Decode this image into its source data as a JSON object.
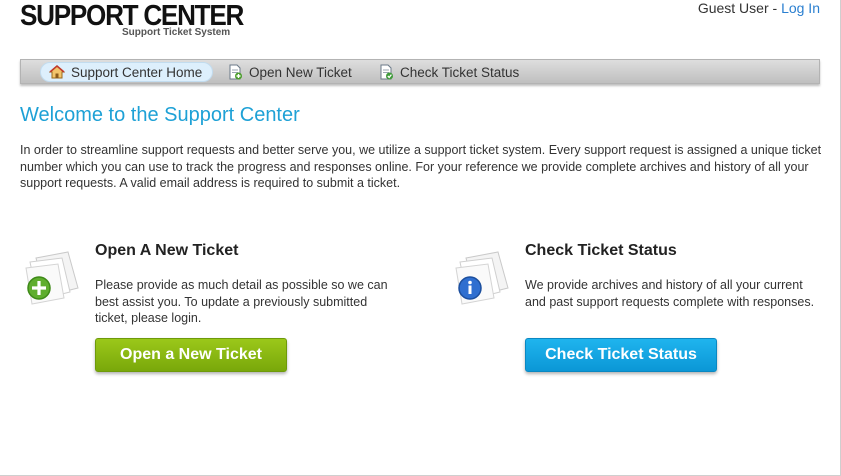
{
  "header": {
    "logo_title": "SUPPORT CENTER",
    "logo_subtitle": "Support Ticket System",
    "user_label": "Guest User - ",
    "login_link": "Log In"
  },
  "nav": {
    "items": [
      {
        "label": "Support Center Home",
        "icon": "home-icon",
        "active": true
      },
      {
        "label": "Open New Ticket",
        "icon": "new-ticket-icon",
        "active": false
      },
      {
        "label": "Check Ticket Status",
        "icon": "ticket-status-icon",
        "active": false
      }
    ]
  },
  "main": {
    "title": "Welcome to the Support Center",
    "intro": "In order to streamline support requests and better serve you, we utilize a support ticket system. Every support request is assigned a unique ticket number which you can use to track the progress and responses online. For your reference we provide complete archives and history of all your support requests. A valid email address is required to submit a ticket.",
    "panels": [
      {
        "title": "Open A New Ticket",
        "text": "Please provide as much detail as possible so we can best assist you. To update a previously submitted ticket, please login.",
        "button": "Open a New Ticket",
        "icon": "new-ticket-plus-icon",
        "color": "#8cbb12"
      },
      {
        "title": "Check Ticket Status",
        "text": "We provide archives and history of all your current and past support requests complete with responses.",
        "button": "Check Ticket Status",
        "icon": "info-ticket-icon",
        "color": "#13a6e4"
      }
    ]
  },
  "colors": {
    "accent_title": "#1ea1d6",
    "link": "#2a7fd0"
  }
}
